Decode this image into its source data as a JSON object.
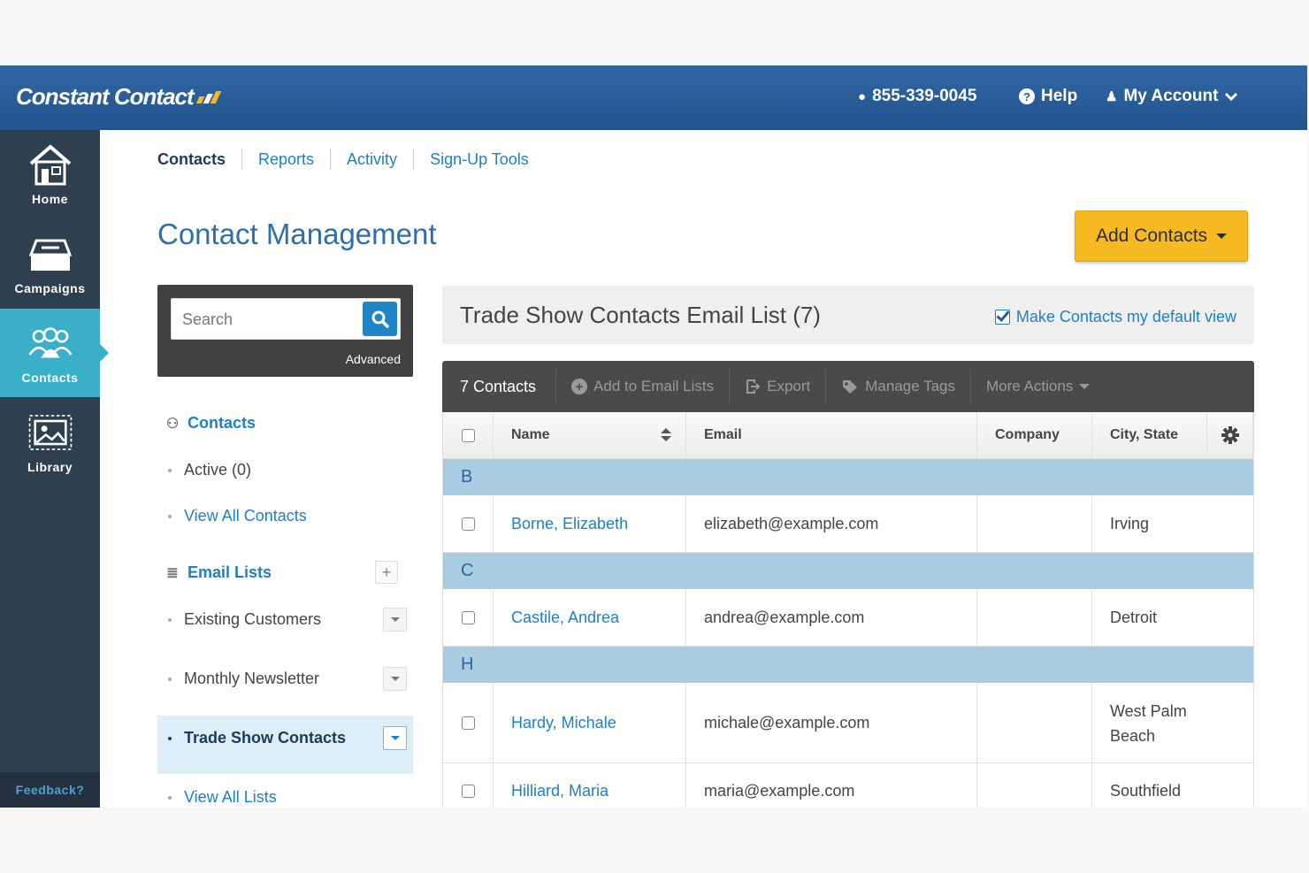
{
  "header": {
    "logo": "Constant Contact",
    "phone": "855-339-0045",
    "help": "Help",
    "account": "My Account"
  },
  "sidebar": {
    "items": [
      {
        "label": "Home",
        "icon": "home-icon"
      },
      {
        "label": "Campaigns",
        "icon": "campaigns-icon"
      },
      {
        "label": "Contacts",
        "icon": "contacts-icon"
      },
      {
        "label": "Library",
        "icon": "library-icon"
      }
    ],
    "feedback": "Feedback?"
  },
  "subnav": {
    "tabs": [
      "Contacts",
      "Reports",
      "Activity",
      "Sign-Up Tools"
    ]
  },
  "page": {
    "title": "Contact Management",
    "add_contacts": "Add Contacts"
  },
  "search": {
    "placeholder": "Search",
    "advanced": "Advanced"
  },
  "left": {
    "contacts_head": "Contacts",
    "active": "Active (0)",
    "view_all_contacts": "View All Contacts",
    "email_lists_head": "Email Lists",
    "lists": [
      "Existing Customers",
      "Monthly Newsletter",
      "Trade Show Contacts"
    ],
    "view_all_lists": "View All Lists"
  },
  "list": {
    "title": "Trade Show Contacts Email List (7)",
    "default_view": "Make Contacts my default view"
  },
  "toolbar": {
    "count": "7 Contacts",
    "add_to_lists": "Add to Email Lists",
    "export": "Export",
    "manage_tags": "Manage Tags",
    "more_actions": "More Actions"
  },
  "table": {
    "headers": {
      "name": "Name",
      "email": "Email",
      "company": "Company",
      "city": "City, State"
    },
    "groups": [
      "B",
      "C",
      "H"
    ],
    "rows": [
      {
        "name": "Borne, Elizabeth",
        "email": "elizabeth@example.com",
        "company": "",
        "city": "Irving"
      },
      {
        "name": "Castile, Andrea",
        "email": "andrea@example.com",
        "company": "",
        "city": "Detroit"
      },
      {
        "name": "Hardy, Michale",
        "email": "michale@example.com",
        "company": "",
        "city": "West Palm Beach"
      },
      {
        "name": "Hilliard, Maria",
        "email": "maria@example.com",
        "company": "",
        "city": "Southfield"
      }
    ]
  },
  "colors": {
    "header_blue": "#2a5d98",
    "sidebar": "#2e3f4f",
    "active_nav": "#3ab0c8",
    "accent_yellow": "#f5b922",
    "link": "#1f7fc8",
    "group_row": "#a9cce1"
  }
}
